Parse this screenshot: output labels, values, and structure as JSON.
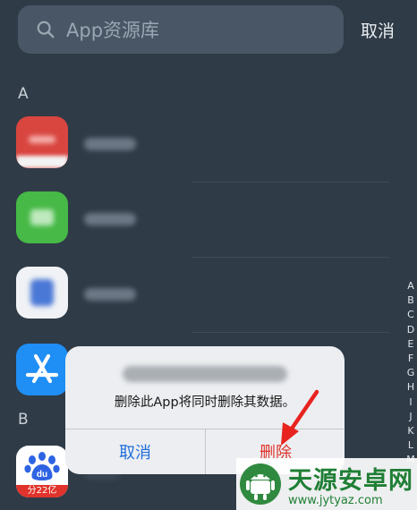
{
  "search": {
    "placeholder": "App资源库",
    "cancel_label": "取消"
  },
  "sections": [
    {
      "letter": "A"
    },
    {
      "letter": "B"
    }
  ],
  "apps": [
    {
      "icon": "red-app-icon",
      "color": "#d9453f"
    },
    {
      "icon": "green-app-icon",
      "color": "#46b946"
    },
    {
      "icon": "blue-app-icon",
      "color": "#4a78d6"
    },
    {
      "icon": "app-store-icon",
      "color": "#1f8ef5"
    },
    {
      "icon": "baidu-icon",
      "color": "#2e63e3",
      "badge": "分22亿"
    }
  ],
  "alphabet_index": [
    "A",
    "B",
    "C",
    "D",
    "E",
    "F",
    "G",
    "H",
    "I",
    "J",
    "K",
    "L",
    "M"
  ],
  "alert": {
    "message": "删除此App将同时删除其数据。",
    "cancel_label": "取消",
    "delete_label": "删除",
    "cancel_color": "#1f6fdb",
    "delete_color": "#e0332b"
  },
  "watermark": {
    "title": "天源安卓网",
    "url": "www.jytyaz.com"
  },
  "colors": {
    "background": "#2f3b47",
    "searchbar": "#495665"
  }
}
